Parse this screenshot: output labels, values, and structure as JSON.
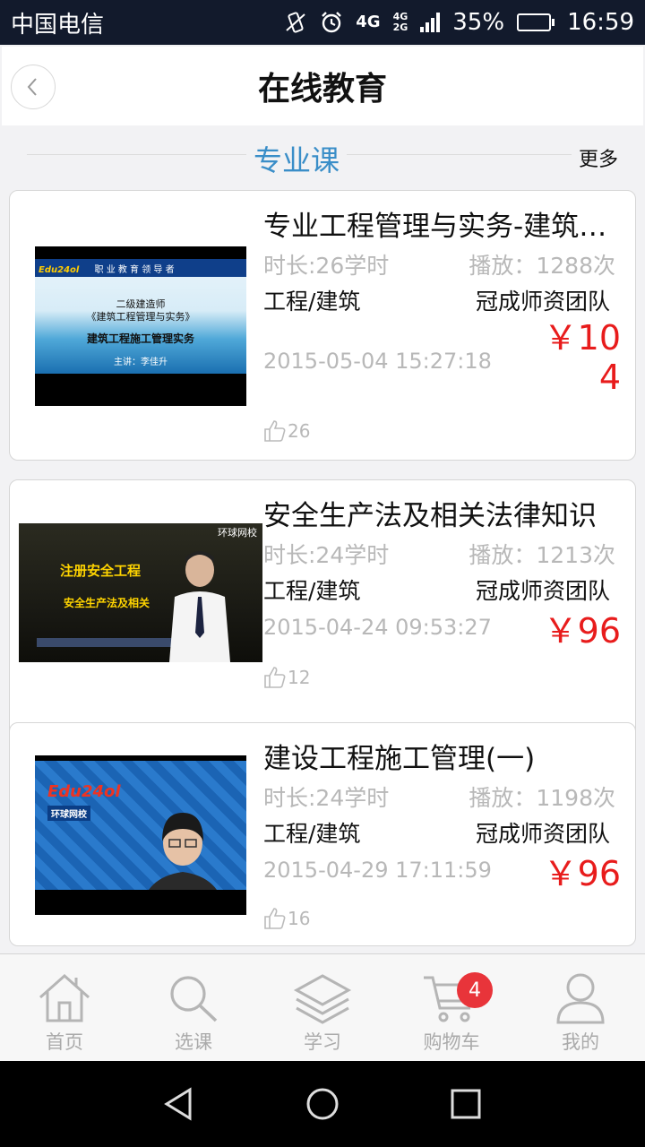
{
  "status_bar": {
    "carrier": "中国电信",
    "network": "4G",
    "network2_top": "4G",
    "network2_bottom": "2G",
    "battery": "35%",
    "battery_level": 0.35,
    "time": "16:59"
  },
  "header": {
    "title": "在线教育"
  },
  "section": {
    "title": "专业课",
    "more": "更多"
  },
  "courses": [
    {
      "title": "专业工程管理与实务-建筑工程施工管理实务",
      "duration": "时长:26学时",
      "plays": "播放：1288次",
      "category": "工程/建筑",
      "teacher": "冠成师资团队",
      "date": "2015-05-04 15:27:18",
      "price": "￥104",
      "likes": "26",
      "thumb": {
        "brand": "职 业 教 育 领 导 者",
        "line1": "二级建造师",
        "line2": "《建筑工程管理与实务》",
        "line3": "建筑工程施工管理实务",
        "line4": "主讲：李佳升"
      }
    },
    {
      "title": "安全生产法及相关法律知识",
      "duration": "时长:24学时",
      "plays": "播放：1213次",
      "category": "工程/建筑",
      "teacher": "冠成师资团队",
      "date": "2015-04-24 09:53:27",
      "price": "￥96",
      "likes": "12",
      "thumb": {
        "brand": "环球网校",
        "line1": "注册安全工程",
        "line2": "安全生产法及相关"
      }
    },
    {
      "title": "建设工程施工管理(一)",
      "duration": "时长:24学时",
      "plays": "播放：1198次",
      "category": "工程/建筑",
      "teacher": "冠成师资团队",
      "date": "2015-04-29 17:11:59",
      "price": "￥96",
      "likes": "16",
      "thumb": {
        "brand": "环球网校"
      }
    }
  ],
  "tabbar": {
    "items": [
      {
        "label": "首页",
        "icon": "home-icon"
      },
      {
        "label": "选课",
        "icon": "search-icon"
      },
      {
        "label": "学习",
        "icon": "layers-icon"
      },
      {
        "label": "购物车",
        "icon": "cart-icon",
        "badge": "4"
      },
      {
        "label": "我的",
        "icon": "user-icon"
      }
    ]
  },
  "colors": {
    "accent": "#3a8ec8",
    "price": "#e81c1c",
    "badge": "#e8343a",
    "status_bar": "#121a2c"
  }
}
